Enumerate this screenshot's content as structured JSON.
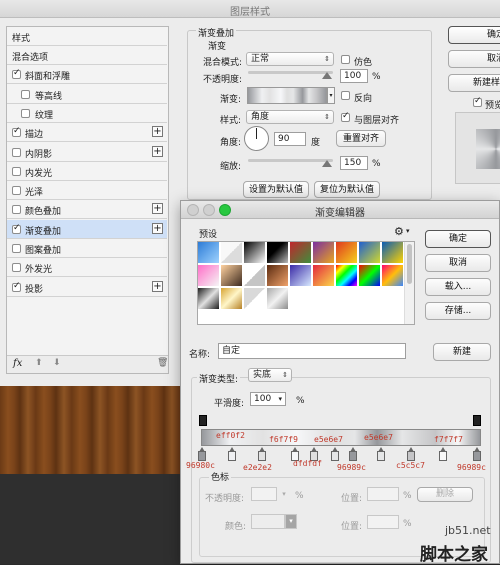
{
  "layer_style": {
    "title": "图层样式",
    "sidebar": {
      "header": "样式",
      "items": [
        {
          "label": "混合选项",
          "checkbox": false,
          "checked": false,
          "plus": false,
          "selected": false
        },
        {
          "label": "斜面和浮雕",
          "checkbox": true,
          "checked": true,
          "plus": false,
          "selected": false
        },
        {
          "label": "等高线",
          "checkbox": true,
          "checked": false,
          "plus": false,
          "selected": false
        },
        {
          "label": "纹理",
          "checkbox": true,
          "checked": false,
          "plus": false,
          "selected": false
        },
        {
          "label": "描边",
          "checkbox": true,
          "checked": true,
          "plus": true,
          "selected": false
        },
        {
          "label": "内阴影",
          "checkbox": true,
          "checked": false,
          "plus": true,
          "selected": false
        },
        {
          "label": "内发光",
          "checkbox": true,
          "checked": false,
          "plus": false,
          "selected": false
        },
        {
          "label": "光泽",
          "checkbox": true,
          "checked": false,
          "plus": false,
          "selected": false
        },
        {
          "label": "颜色叠加",
          "checkbox": true,
          "checked": false,
          "plus": true,
          "selected": false
        },
        {
          "label": "渐变叠加",
          "checkbox": true,
          "checked": true,
          "plus": true,
          "selected": true
        },
        {
          "label": "图案叠加",
          "checkbox": true,
          "checked": false,
          "plus": false,
          "selected": false
        },
        {
          "label": "外发光",
          "checkbox": true,
          "checked": false,
          "plus": false,
          "selected": false
        },
        {
          "label": "投影",
          "checkbox": true,
          "checked": true,
          "plus": true,
          "selected": false
        }
      ],
      "fx_label": "fx"
    },
    "gradient_overlay": {
      "section_title": "渐变叠加",
      "sub_title": "渐变",
      "blend_mode_label": "混合模式:",
      "blend_mode_value": "正常",
      "dither_label": "仿色",
      "opacity_label": "不透明度:",
      "opacity_value": "100",
      "opacity_unit": "%",
      "gradient_label": "渐变:",
      "reverse_label": "反向",
      "style_label": "样式:",
      "style_value": "角度",
      "align_label": "与图层对齐",
      "angle_label": "角度:",
      "angle_value": "90",
      "angle_unit": "度",
      "reset_align_label": "重置对齐",
      "scale_label": "缩放:",
      "scale_value": "150",
      "scale_unit": "%",
      "set_default_label": "设置为默认值",
      "reset_default_label": "复位为默认值"
    },
    "right_buttons": {
      "ok": "确定",
      "cancel": "取消",
      "new_style": "新建样",
      "preview": "预览"
    }
  },
  "gradient_editor": {
    "title": "渐变编辑器",
    "presets_label": "预设",
    "buttons": {
      "ok": "确定",
      "cancel": "取消",
      "load": "载入...",
      "save": "存储...",
      "new": "新建"
    },
    "name_label": "名称:",
    "name_value": "自定",
    "gradient_type_label": "渐变类型:",
    "gradient_type_value": "实底",
    "smoothness_label": "平滑度:",
    "smoothness_value": "100",
    "smoothness_unit": "%",
    "stops_group_label": "色标",
    "opacity_label": "不透明度:",
    "opacity_unit": "%",
    "location_label": "位置:",
    "location_unit": "%",
    "delete_label": "删除",
    "color_label": "颜色:",
    "stop_labels_top": [
      "eff0f2",
      "f6f7f9",
      "e5e6e7",
      "e5e6e7",
      "f7f7f7"
    ],
    "stop_labels_bottom": [
      "96980c",
      "e2e2e2",
      "dfdfdf",
      "96989c",
      "c5c5c7",
      "96989c"
    ]
  },
  "watermark": {
    "site": "jb51.net",
    "brand": "脚本之家"
  },
  "colors": {
    "stop_label": "#c0392b",
    "selected_row": "#cfe0f7",
    "mac_red": "#fc5f57",
    "mac_yellow": "#fdbc2e",
    "mac_green": "#28c840"
  }
}
